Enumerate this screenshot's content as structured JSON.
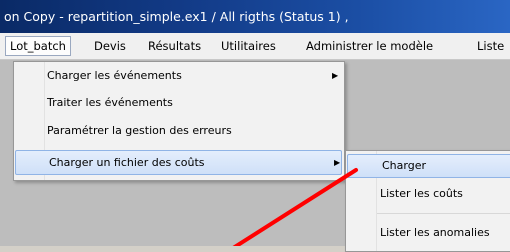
{
  "window": {
    "title": "on Copy - repartition_simple.ex1  /  All rigths (Status 1)  ,"
  },
  "menubar": {
    "items": [
      "Lot_batch",
      "Devis",
      "Résultats",
      "Utilitaires",
      "Administrer le modèle",
      "Liste"
    ]
  },
  "dropdown": {
    "items": [
      {
        "label": "Charger les événements",
        "has_submenu": true
      },
      {
        "label": "Traiter les événements",
        "has_submenu": false
      },
      {
        "label": "Paramétrer la gestion des erreurs",
        "has_submenu": false
      },
      {
        "label": "Charger un fichier des coûts",
        "has_submenu": true
      }
    ]
  },
  "submenu": {
    "items": [
      "Charger",
      "Lister les coûts",
      "Lister les anomalies"
    ]
  },
  "colors": {
    "annotation_arrow": "#ff0000",
    "highlight": "#cfe0f8"
  }
}
